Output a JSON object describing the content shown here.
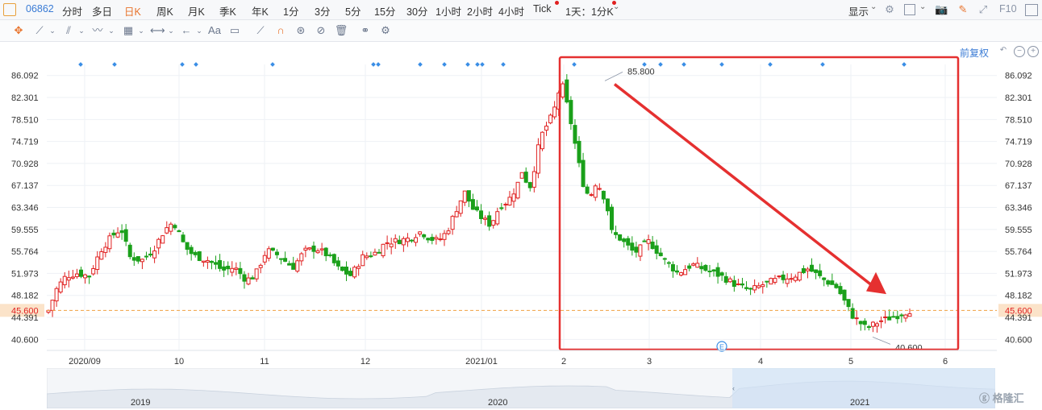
{
  "toolbar": {
    "stock_code": "06862",
    "periods": [
      "分时",
      "多日",
      "日K",
      "周K",
      "月K",
      "季K",
      "年K",
      "1分",
      "3分",
      "5分",
      "15分",
      "30分",
      "1小时",
      "2小时",
      "4小时",
      "Tick",
      "1天：1分K"
    ],
    "active_period": "日K",
    "display_label": "显示",
    "right_text": "F10"
  },
  "chart": {
    "adjust_label": "前复权",
    "y_ticks": [
      "86.092",
      "82.301",
      "78.510",
      "74.719",
      "70.928",
      "67.137",
      "63.346",
      "59.555",
      "55.764",
      "51.973",
      "48.182",
      "45.600",
      "44.391",
      "40.600"
    ],
    "x_ticks": [
      "2020/09",
      "10",
      "11",
      "12",
      "2021/01",
      "2",
      "3",
      "4",
      "5",
      "6"
    ],
    "high_label": "85.800",
    "low_label": "40.600",
    "current_price": "45.600",
    "earnings_marker": "E",
    "colors": {
      "up": "#e02020",
      "down": "#1aa01a",
      "annotation": "#e53030",
      "current_line": "#f0a040"
    }
  },
  "navigator": {
    "years": [
      "2019",
      "2020",
      "2021"
    ]
  },
  "chart_data": {
    "type": "candlestick",
    "ylim": [
      38.7,
      88.0
    ],
    "x_labels": [
      "2020/09",
      "10",
      "11",
      "12",
      "2021/01",
      "2",
      "3",
      "4",
      "5",
      "6"
    ],
    "annotations": [
      {
        "text": "85.800",
        "kind": "high"
      },
      {
        "text": "40.600",
        "kind": "low"
      }
    ],
    "current_price": 45.6
  }
}
